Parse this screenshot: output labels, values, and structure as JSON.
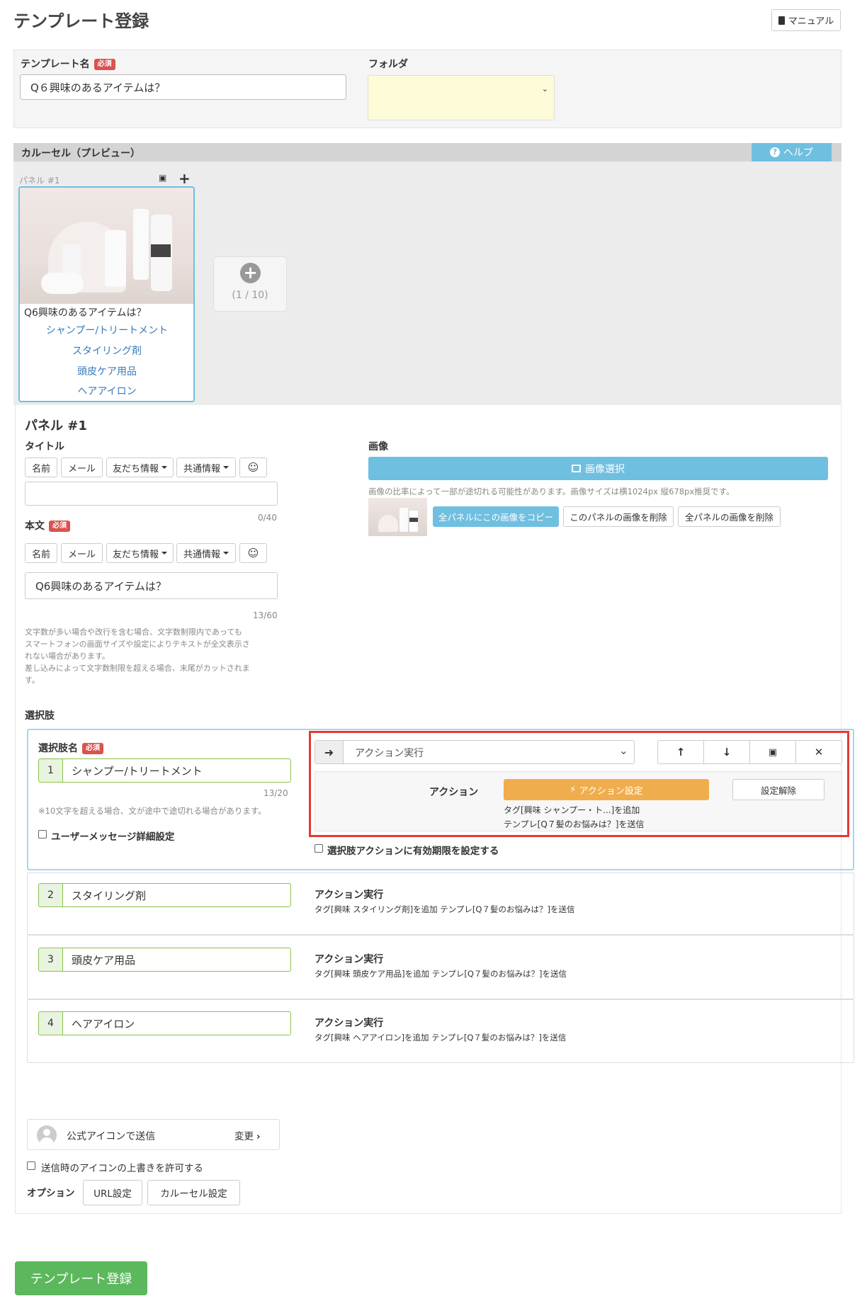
{
  "page_title": "テンプレート登録",
  "manual_button": "マニュアル",
  "template_name": {
    "label": "テンプレート名",
    "required": "必須",
    "value": "Q６興味のあるアイテムは？"
  },
  "folder": {
    "label": "フォルダ",
    "value": ""
  },
  "carousel": {
    "header": "カルーセル（プレビュー）",
    "help": "ヘルプ",
    "panel_label": "パネル #1",
    "preview_text": "Q6興味のあるアイテムは？",
    "preview_choices": [
      "シャンプー/トリートメント",
      "スタイリング剤",
      "頭皮ケア用品",
      "ヘアアイロン"
    ],
    "add_count": "(1 / 10)"
  },
  "panel": {
    "heading": "パネル #1",
    "title_label": "タイトル",
    "insert_buttons": [
      "名前",
      "メール",
      "友だち情報",
      "共通情報"
    ],
    "title_count": "0/40",
    "body_label": "本文",
    "required": "必須",
    "body_value": "Q6興味のあるアイテムは？",
    "body_count": "13/60",
    "body_note1": "文字数が多い場合や改行を含む場合、文字数制限内であっても",
    "body_note2": "スマートフォンの画面サイズや設定によりテキストが全文表示さ",
    "body_note3": "れない場合があります。",
    "body_note4": "差し込みによって文字数制限を超える場合、末尾がカットされま",
    "body_note5": "す。",
    "image_label": "画像",
    "image_select": "画像選択",
    "image_note": "画像の比率によって一部が途切れる可能性があります。画像サイズは横1024px 縦678px推奨です。",
    "copy_all": "全パネルにこの画像をコピー",
    "delete_this": "このパネルの画像を削除",
    "delete_all": "全パネルの画像を削除"
  },
  "choices_label": "選択肢",
  "choice_editor": {
    "name_label": "選択肢名",
    "required": "必須",
    "num": "1",
    "value": "シャンプー/トリートメント",
    "count": "13/20",
    "note": "※10文字を超える場合、文が途中で途切れる場合があります。",
    "user_msg": "ユーザーメッセージ詳細設定",
    "action_select": "アクション実行",
    "action_label": "アクション",
    "action_setting": "アクション設定",
    "action_clear": "設定解除",
    "action_desc1": "タグ[興味 シャンプー・ト...]を追加",
    "action_desc2": "テンプレ[Q７髪のお悩みは？]を送信",
    "expire": "選択肢アクションに有効期限を設定する"
  },
  "choices": [
    {
      "num": "2",
      "value": "スタイリング剤",
      "action": "アクション実行",
      "desc": "タグ[興味 スタイリング剤]を追加 テンプレ[Q７髪のお悩みは？]を送信"
    },
    {
      "num": "3",
      "value": "頭皮ケア用品",
      "action": "アクション実行",
      "desc": "タグ[興味 頭皮ケア用品]を追加 テンプレ[Q７髪のお悩みは？]を送信"
    },
    {
      "num": "4",
      "value": "ヘアアイロン",
      "action": "アクション実行",
      "desc": "タグ[興味 ヘアアイロン]を追加 テンプレ[Q７髪のお悩みは？]を送信"
    }
  ],
  "sender": {
    "label": "公式アイコンで送信",
    "change": "変更"
  },
  "allow_override": "送信時のアイコンの上書きを許可する",
  "options": {
    "label": "オプション",
    "url": "URL設定",
    "carousel": "カルーセル設定"
  },
  "submit": "テンプレート登録",
  "colors": {
    "accent": "#5bc0de",
    "help": "#6fbfe0",
    "submit": "#5cb85c",
    "action": "#f0ad4e",
    "highlight": "#e53935",
    "required": "#d9534f"
  }
}
